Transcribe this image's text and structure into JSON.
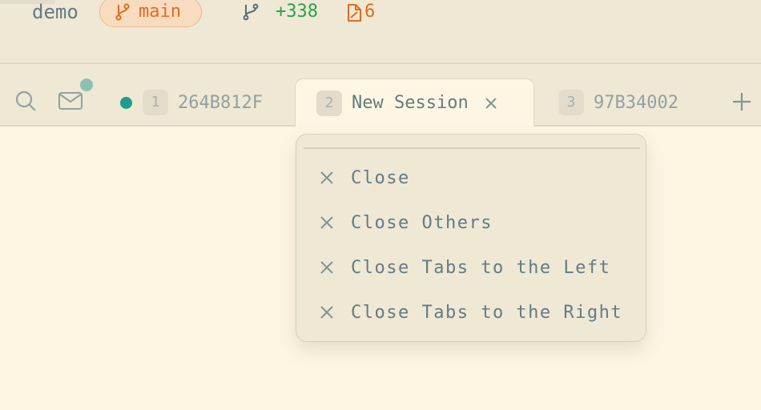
{
  "header": {
    "project_name": "demo",
    "branch": "main",
    "added_lines": "+338",
    "modified_files": "6"
  },
  "tabs": [
    {
      "number": "1",
      "label": "264B812F",
      "active": false,
      "status": "running"
    },
    {
      "number": "2",
      "label": "New Session",
      "active": true
    },
    {
      "number": "3",
      "label": "97B34002",
      "active": false
    }
  ],
  "context_menu": {
    "items": [
      {
        "label": "Close"
      },
      {
        "label": "Close Others"
      },
      {
        "label": "Close Tabs to the Left"
      },
      {
        "label": "Close Tabs to the Right"
      }
    ]
  },
  "colors": {
    "background": "#fdf6e3",
    "bar": "#eee8d5",
    "branch_accent": "#e56a1e",
    "added_green": "#2aa14a",
    "status_teal": "#1f9c8e"
  },
  "icons": [
    "git-branch-icon",
    "git-icon",
    "file-diff-icon",
    "search-icon",
    "mail-icon",
    "close-icon",
    "plus-icon"
  ]
}
